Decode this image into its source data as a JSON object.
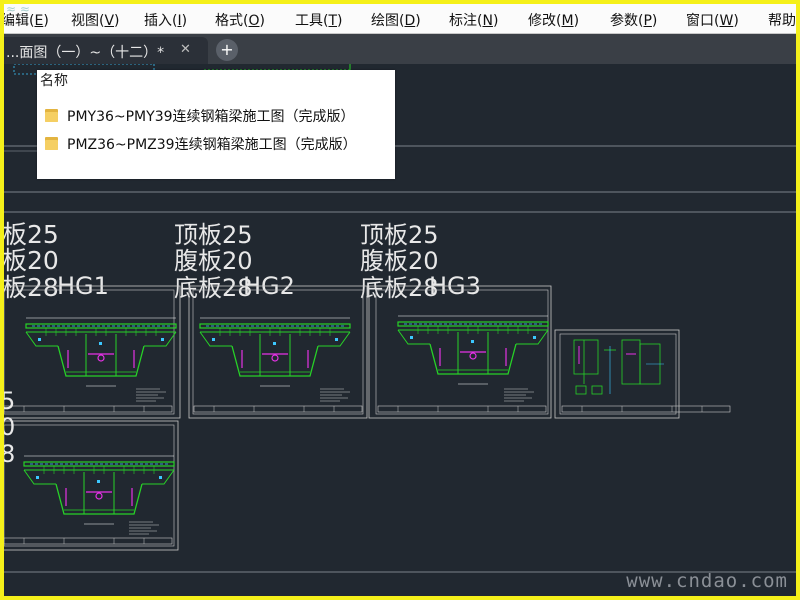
{
  "menubar": {
    "items": [
      {
        "label": "编辑(",
        "key": "E",
        "tail": ")"
      },
      {
        "label": "视图(",
        "key": "V",
        "tail": ")"
      },
      {
        "label": "插入(",
        "key": "I",
        "tail": ")"
      },
      {
        "label": "格式(",
        "key": "O",
        "tail": ")"
      },
      {
        "label": "工具(",
        "key": "T",
        "tail": ")"
      },
      {
        "label": "绘图(",
        "key": "D",
        "tail": ")"
      },
      {
        "label": "标注(",
        "key": "N",
        "tail": ")"
      },
      {
        "label": "修改(",
        "key": "M",
        "tail": ")"
      },
      {
        "label": "参数(",
        "key": "P",
        "tail": ")"
      },
      {
        "label": "窗口(",
        "key": "W",
        "tail": ")"
      },
      {
        "label": "帮助",
        "key": "",
        "tail": ""
      }
    ]
  },
  "tabs": {
    "active_title": "...面图（一）~（十二）*",
    "close_glyph": "✕",
    "add_glyph": "+"
  },
  "popup": {
    "header": "名称",
    "files": [
      {
        "name": "PMY36~PMY39连续钢箱梁施工图（完成版）",
        "icon": "folder-icon"
      },
      {
        "name": "PMZ36~PMZ39连续钢箱梁施工图（完成版）",
        "icon": "folder-icon"
      }
    ]
  },
  "drawing": {
    "groups": [
      {
        "lines": [
          "板25",
          "板20",
          "板28"
        ],
        "tag": "HG1"
      },
      {
        "lines": [
          "顶板25",
          "腹板20",
          "底板28"
        ],
        "tag": "HG2"
      },
      {
        "lines": [
          "顶板25",
          "腹板20",
          "底板28"
        ],
        "tag": "HG3"
      }
    ],
    "lower_left_digits": [
      "5",
      "0",
      "8"
    ]
  },
  "watermark": {
    "bottom": "www.cndao.com"
  },
  "colors": {
    "canvas_bg": "#212830",
    "frame_border": "#f5f01a",
    "section_green": "#27d227",
    "section_magenta": "#e632e6",
    "section_cyan": "#3cc8ff"
  }
}
